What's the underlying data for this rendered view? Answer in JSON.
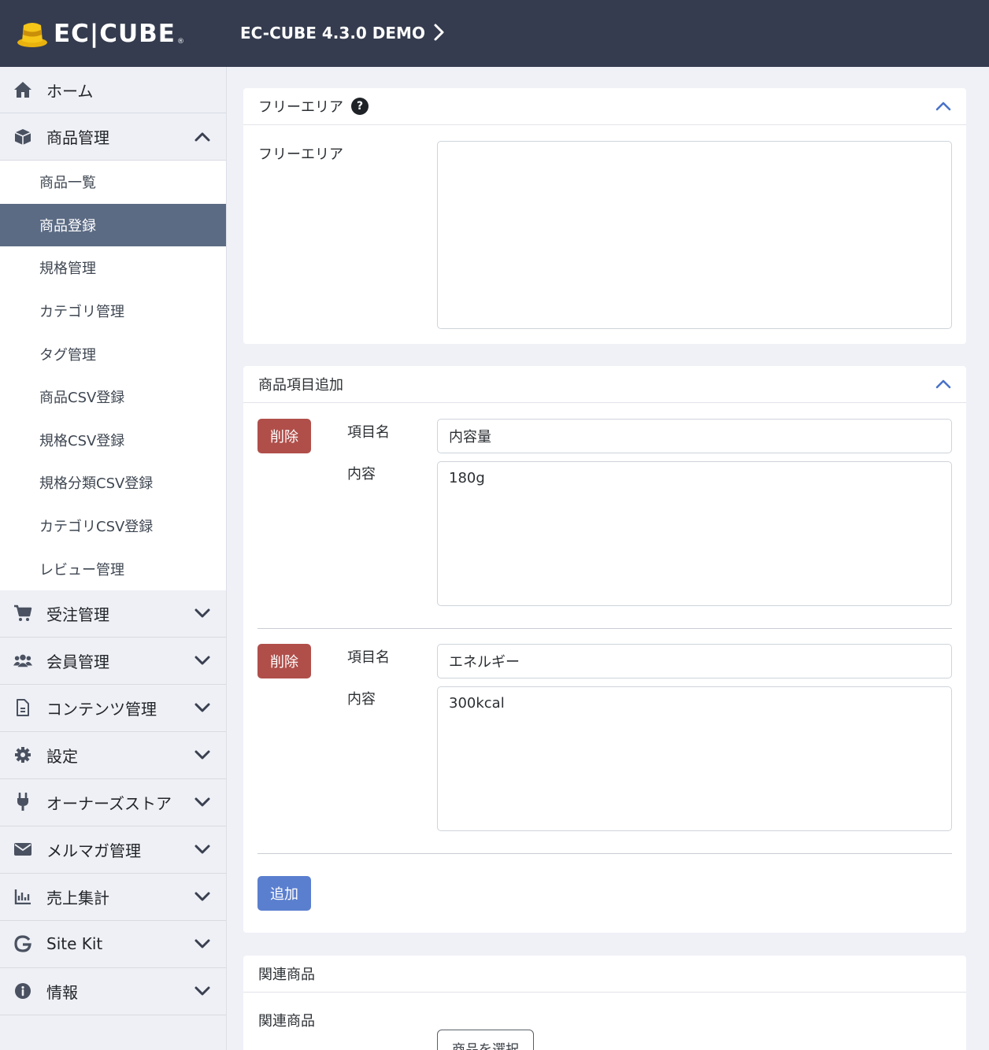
{
  "header": {
    "logo_text": "EC|CUBE",
    "logo_reg": "®",
    "shop_name": "EC-CUBE 4.3.0 DEMO"
  },
  "sidebar": {
    "home": "ホーム",
    "product": "商品管理",
    "product_sub": [
      "商品一覧",
      "商品登録",
      "規格管理",
      "カテゴリ管理",
      "タグ管理",
      "商品CSV登録",
      "規格CSV登録",
      "規格分類CSV登録",
      "カテゴリCSV登録",
      "レビュー管理"
    ],
    "order": "受注管理",
    "customer": "会員管理",
    "content": "コンテンツ管理",
    "setting": "設定",
    "store": "オーナーズストア",
    "mail": "メルマガ管理",
    "sales": "売上集計",
    "sitekit": "Site Kit",
    "info": "情報"
  },
  "free_area": {
    "title": "フリーエリア",
    "help": "?",
    "label": "フリーエリア",
    "value": ""
  },
  "add_items": {
    "title": "商品項目追加",
    "delete_label": "削除",
    "name_label": "項目名",
    "content_label": "内容",
    "items": [
      {
        "name": "内容量",
        "content": "180g"
      },
      {
        "name": "エネルギー",
        "content": "300kcal"
      }
    ],
    "add_label": "追加"
  },
  "related": {
    "title": "関連商品",
    "label": "関連商品",
    "select_label": "商品を選択"
  },
  "colors": {
    "header_bg": "#353c4f",
    "active_nav": "#5c6b84",
    "delete_btn": "#b04f4a",
    "add_btn": "#5b7fcf",
    "accent": "#4a72c8"
  }
}
